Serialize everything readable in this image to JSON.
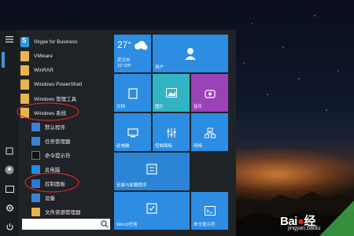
{
  "start_menu": {
    "apps": [
      {
        "label": "Skype for Business",
        "icon": "skype-icon"
      },
      {
        "label": "VMware",
        "icon": "folder-icon"
      },
      {
        "label": "WinRAR",
        "icon": "folder-icon"
      },
      {
        "label": "Windows PowerShell",
        "icon": "folder-icon"
      },
      {
        "label": "Windows 管理工具",
        "icon": "folder-icon"
      },
      {
        "label": "Windows 系统",
        "icon": "folder-icon"
      },
      {
        "label": "默认程序",
        "icon": "default-programs-icon"
      },
      {
        "label": "任务管理器",
        "icon": "task-manager-icon"
      },
      {
        "label": "命令提示符",
        "icon": "command-prompt-icon"
      },
      {
        "label": "此电脑",
        "icon": "this-pc-icon"
      },
      {
        "label": "控制面板",
        "icon": "control-panel-icon"
      },
      {
        "label": "设备",
        "icon": "devices-icon"
      },
      {
        "label": "文件资源管理器",
        "icon": "file-explorer-icon"
      }
    ],
    "search_placeholder": ""
  },
  "tiles": {
    "weather": {
      "temp": "27°",
      "city": "武汉市",
      "range": "31°/24°",
      "condition_icon": "cloudy-icon"
    },
    "items": [
      {
        "label": "用户",
        "icon": "user-icon"
      },
      {
        "label": "文档",
        "icon": "document-icon"
      },
      {
        "label": "图片",
        "icon": "picture-icon"
      },
      {
        "label": "音乐",
        "icon": "music-icon"
      },
      {
        "label": "此电脑",
        "icon": "computer-icon"
      },
      {
        "label": "控制面板",
        "icon": "sliders-icon"
      },
      {
        "label": "网络",
        "icon": "network-icon"
      },
      {
        "label": "安装与卸载程序",
        "icon": "install-icon"
      },
      {
        "label": "Win10任务",
        "icon": "task-icon"
      },
      {
        "label": "命令提示符",
        "icon": "cmd-icon"
      }
    ]
  },
  "watermark": {
    "brand": "Bai",
    "brand2": "经",
    "url": "jingyan.baidu"
  },
  "colors": {
    "tile_blue": "#2c8de3",
    "tile_teal": "#31b3c3",
    "tile_purple": "#9a43b6",
    "menu_bg": "#1f2226"
  }
}
